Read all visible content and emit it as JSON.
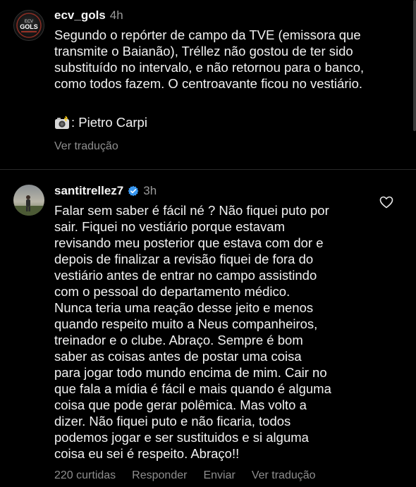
{
  "post": {
    "username": "ecv_gols",
    "time": "4h",
    "text": "Segundo o repórter de campo da TVE (emissora que\ntransmite o Baianão), Tréllez não gostou de ter sido\nsubstituído no intervalo, e não retornou para o banco,\ncomo todos fazem. O centroavante ficou no vestiário.",
    "credit": ": Pietro Carpi",
    "translate_label": "Ver tradução",
    "avatar_text": "ECV\nGOLS"
  },
  "comment": {
    "username": "santitrellez7",
    "time": "3h",
    "text": "Falar sem saber é fácil né ? Não fiquei puto por\nsair. Fiquei no vestiário porque estavam\nrevisando meu posterior que estava com dor e\ndepois de finalizar a revisão fiquei de fora do\nvestiário antes de entrar no campo assistindo\ncom o pessoal do departamento médico.\nNunca teria uma reação desse jeito e menos\nquando respeito muito a Neus companheiros,\ntreinador e o clube. Abraço. Sempre é bom\nsaber as coisas antes de postar uma coisa\npara jogar todo mundo encima de mim. Cair no\nque fala a mídia é fácil e mais quando é alguma\ncoisa que pode gerar polêmica. Mas volto a\ndizer. Não fiquei puto e não ficaria, todos\npodemos jogar e ser sustituidos e si alguma\ncoisa eu sei é respeito. Abraço!!",
    "likes": "220 curtidas",
    "reply_label": "Responder",
    "send_label": "Enviar",
    "translate_label": "Ver tradução"
  },
  "colors": {
    "background": "#000000",
    "text": "#f2f2f2",
    "muted": "#8e8e8e",
    "verified": "#3897f0"
  },
  "icons": {
    "verified": "verified-badge-icon",
    "heart": "heart-outline-icon",
    "camera": "camera-flash-icon"
  }
}
